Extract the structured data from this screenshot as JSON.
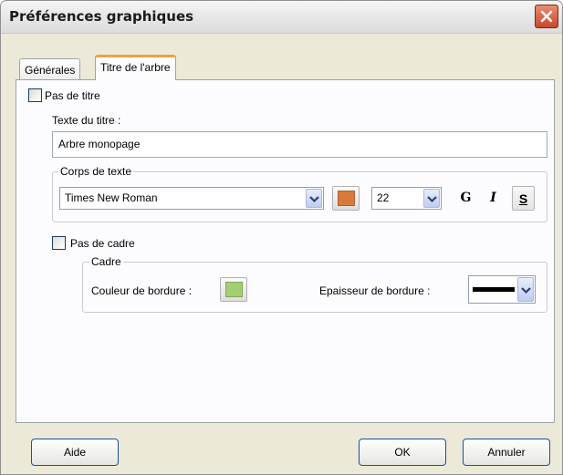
{
  "window": {
    "title": "Préférences graphiques"
  },
  "tabs": [
    {
      "label": "Générales",
      "active": false
    },
    {
      "label": "Titre de l'arbre",
      "active": true
    }
  ],
  "title_section": {
    "no_title_checkbox": {
      "label": "Pas de titre",
      "checked": false
    },
    "title_text_label": "Texte du titre :",
    "title_text_value": "Arbre monopage"
  },
  "text_body": {
    "legend": "Corps de texte",
    "font_family": "Times New Roman",
    "font_color": "#d97a3c",
    "font_size": "22",
    "bold_label": "G",
    "italic_label": "I",
    "underline_label": "S"
  },
  "frame_section": {
    "no_frame_checkbox": {
      "label": "Pas de cadre",
      "checked": false
    },
    "legend": "Cadre",
    "border_color_label": "Couleur de bordure :",
    "border_color": "#a3cf72",
    "border_width_label": "Epaisseur de bordure :"
  },
  "footer": {
    "help_label": "Aide",
    "ok_label": "OK",
    "cancel_label": "Annuler"
  },
  "colors": {
    "active_tab_accent": "#f2a23c",
    "close_button": "#c9462c"
  },
  "icons": {
    "close": "close-icon",
    "dropdown": "chevron-down-icon"
  }
}
